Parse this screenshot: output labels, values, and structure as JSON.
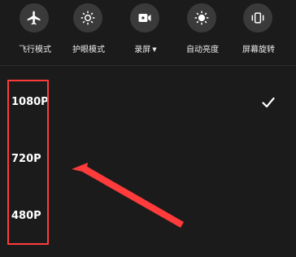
{
  "toggles": [
    {
      "label": "飞行模式",
      "icon": "airplane-icon"
    },
    {
      "label": "护眼模式",
      "icon": "eye-comfort-icon"
    },
    {
      "label": "录屏",
      "icon": "video-record-icon",
      "has_dropdown": true
    },
    {
      "label": "自动亮度",
      "icon": "brightness-icon"
    },
    {
      "label": "屏幕旋转",
      "icon": "screen-rotate-icon"
    }
  ],
  "resolutions": [
    {
      "label": "1080P",
      "selected": true
    },
    {
      "label": "720P",
      "selected": false
    },
    {
      "label": "480P",
      "selected": false
    }
  ],
  "colors": {
    "background": "#1b1b1b",
    "toggle_bg": "#3a3a3a",
    "annotation": "#ff3b3b"
  }
}
